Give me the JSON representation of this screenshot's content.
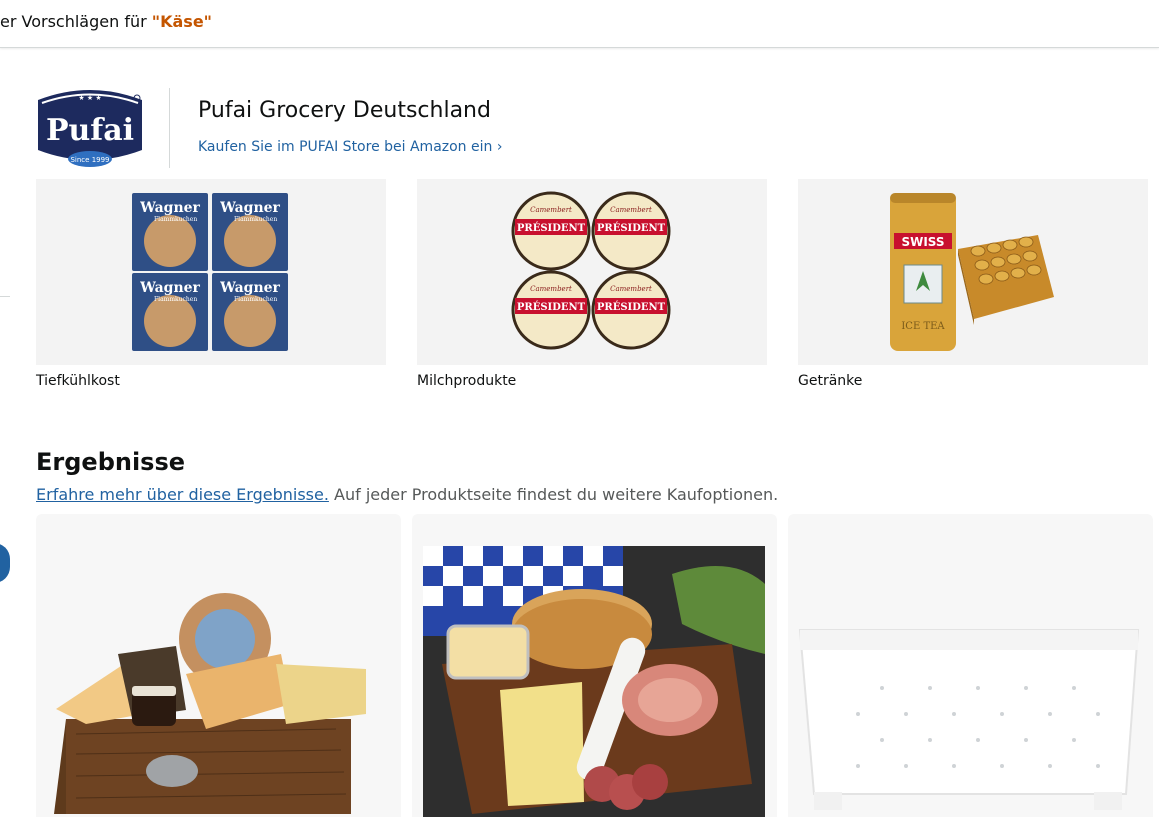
{
  "topbar": {
    "prefix": "er Vorschlägen für ",
    "query": "\"Käse\""
  },
  "brand": {
    "logo_text": "Pufai",
    "logo_since": "Since 1999",
    "name": "Pufai Grocery Deutschland",
    "link": "Kaufen Sie im PUFAI Store bei Amazon ein ›"
  },
  "categories": [
    {
      "label": "Tiefkühlkost",
      "product_text": "Wagner",
      "product_sub": "Flammkuchen"
    },
    {
      "label": "Milchprodukte",
      "product_text": "PRÉSIDENT",
      "product_sub": "Camembert"
    },
    {
      "label": "Getränke",
      "product_text": "SWISS",
      "product_sub": "ICE TEA"
    }
  ],
  "results": {
    "title": "Ergebnisse",
    "link": "Erfahre mehr über diese Ergebnisse.",
    "text": " Auf jeder Produktseite findest du weitere Kaufoptionen."
  },
  "colors": {
    "link": "#2162a1",
    "query": "#c45500",
    "text": "#0f1111",
    "muted": "#565959"
  }
}
